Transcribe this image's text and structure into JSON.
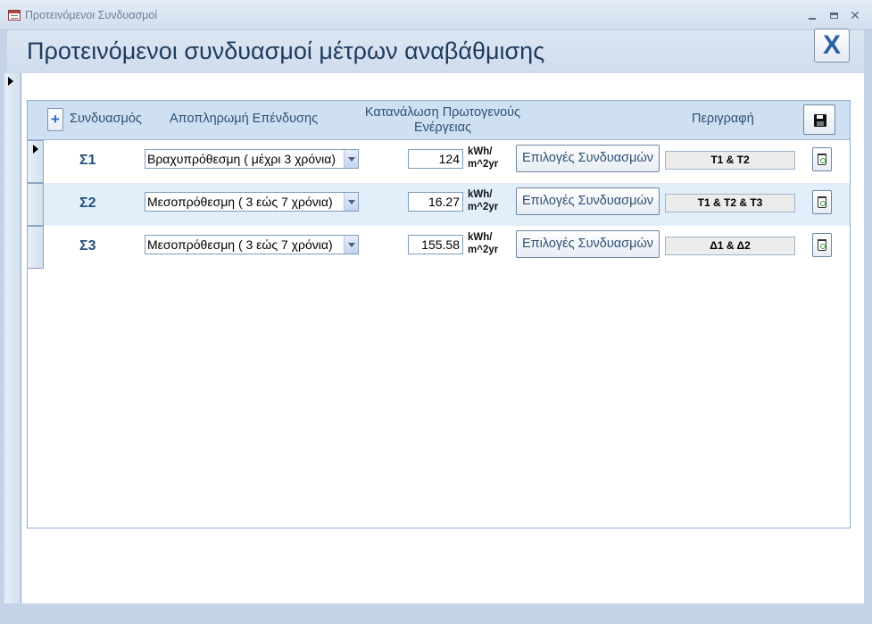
{
  "window": {
    "title": "Προτεινόμενοι Συνδυασμοί",
    "minimize_icon": "minimize-icon",
    "maximize_icon": "maximize-icon",
    "close_glyph": "✕"
  },
  "form": {
    "title": "Προτεινόμενοι συνδυασμοί μέτρων αναβάθμισης",
    "close_button_label": "X"
  },
  "columns": {
    "add_label": "+",
    "combination": "Συνδυασμός",
    "investment_payback": "Αποπληρωμή Επένδυσης",
    "primary_energy": "Κατανάλωση Πρωτογενούς Ενέργειας",
    "description": "Περιγραφή"
  },
  "rows": [
    {
      "name": "Σ1",
      "payback": "Βραχυπρόθεσμη ( μέχρι 3 χρόνια)",
      "energy": "124",
      "unit_line1": "kWh/",
      "unit_line2": "m^2yr",
      "choices_label": "Επιλογές Συνδυασμών",
      "description": "Τ1 & Τ2"
    },
    {
      "name": "Σ2",
      "payback": "Μεσοπρόθεσμη ( 3 εώς 7 χρόνια)",
      "energy": "16.27",
      "unit_line1": "kWh/",
      "unit_line2": "m^2yr",
      "choices_label": "Επιλογές Συνδυασμών",
      "description": "Τ1 & Τ2 & Τ3"
    },
    {
      "name": "Σ3",
      "payback": "Μεσοπρόθεσμη ( 3 εώς 7 χρόνια)",
      "energy": "155.58",
      "unit_line1": "kWh/",
      "unit_line2": "m^2yr",
      "choices_label": "Επιλογές Συνδυασμών",
      "description": "Δ1 & Δ2"
    }
  ],
  "colors": {
    "header_bg": "#cfe0f3",
    "alt_row_bg": "#e3eefb",
    "title_text": "#1f3b5e",
    "accent_blue": "#2b5fa5"
  }
}
